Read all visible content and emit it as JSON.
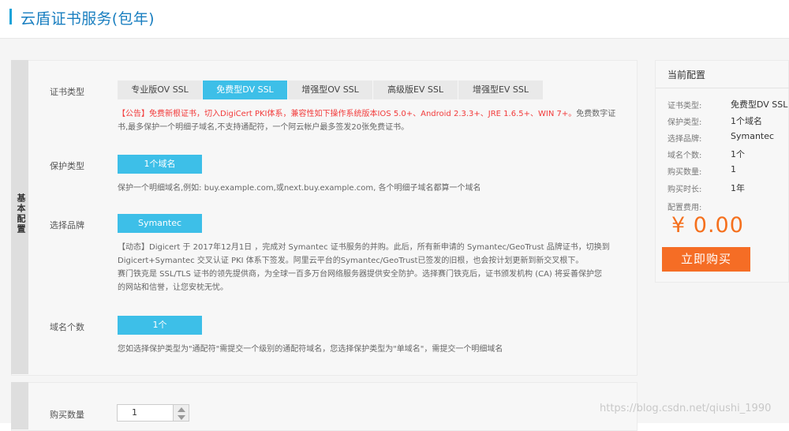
{
  "page_title": "云盾证书服务(包年)",
  "section_tab_label": "基本配置",
  "cert_type": {
    "label": "证书类型",
    "options": [
      "专业版OV SSL",
      "免费型DV SSL",
      "增强型OV SSL",
      "高级版EV SSL",
      "增强型EV SSL"
    ],
    "selected": "免费型DV SSL",
    "notice_red": "【公告】免费新根证书，切入DigiCert PKI体系，兼容性如下操作系统版本IOS 5.0+、Android 2.3.3+、JRE 1.6.5+、WIN 7+。",
    "notice_gray_1": "免费数字证",
    "notice_gray_2": "书,最多保护一个明细子域名,不支持通配符，一个阿云帐户最多签发20张免费证书。"
  },
  "protection_type": {
    "label": "保护类型",
    "value": "1个域名",
    "desc": "保护一个明细域名,例如: buy.example.com,或next.buy.example.com, 各个明细子域名都算一个域名"
  },
  "brand": {
    "label": "选择品牌",
    "value": "Symantec",
    "desc_lines": [
      "【动态】Digicert 于 2017年12月1日 ，完成对 Symantec 证书服务的并购。此后，所有新申请的 Symantec/GeoTrust 品牌证书，切换到",
      "Digicert+Symantec 交叉认证 PKI 体系下签发。阿里云平台的Symantec/GeoTrust已签发的旧根，也会按计划更新到新交叉根下。",
      "赛门铁克是 SSL/TLS 证书的领先提供商，为全球一百多万台网络服务器提供安全防护。选择赛门铁克后，证书颁发机构 (CA) 将妥善保护您",
      "的网站和信誉，让您安枕无忧。"
    ]
  },
  "domain_count": {
    "label": "域名个数",
    "value": "1个",
    "desc": "您如选择保护类型为\"通配符\"需提交一个级别的通配符域名，您选择保护类型为\"单域名\"，需提交一个明细域名"
  },
  "quantity": {
    "label": "购买数量",
    "value": "1"
  },
  "summary": {
    "title": "当前配置",
    "items": [
      {
        "label": "证书类型:",
        "value": "免费型DV SSL"
      },
      {
        "label": "保护类型:",
        "value": "1个域名"
      },
      {
        "label": "选择品牌:",
        "value": "Symantec"
      },
      {
        "label": "域名个数:",
        "value": "1个"
      },
      {
        "label": "购买数量:",
        "value": "1"
      },
      {
        "label": "购买时长:",
        "value": "1年"
      }
    ],
    "fee_label": "配置费用:",
    "price": "¥ 0.00",
    "buy_button": "立即购买"
  },
  "watermark": "https://blog.csdn.net/qiushi_1990",
  "colors": {
    "accent": "#3dbfe8",
    "title": "#1a7fc0",
    "price": "#f5701d",
    "buy_button": "#f56d25",
    "notice": "#f23a3a"
  }
}
